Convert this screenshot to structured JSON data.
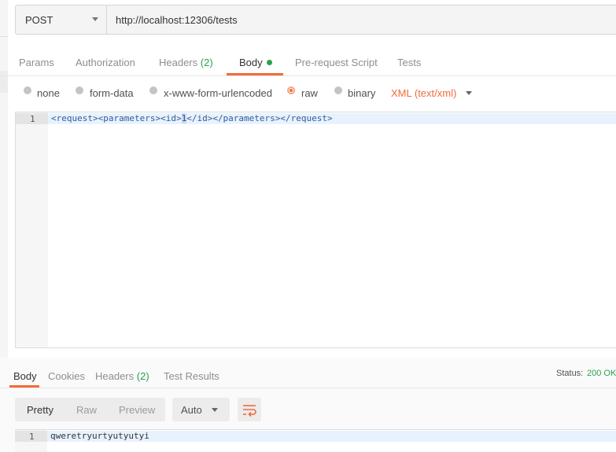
{
  "request": {
    "method": "POST",
    "url": "http://localhost:12306/tests"
  },
  "request_tabs": [
    {
      "label": "Params"
    },
    {
      "label": "Authorization"
    },
    {
      "label": "Headers",
      "count": "(2)"
    },
    {
      "label": "Body"
    },
    {
      "label": "Pre-request Script"
    },
    {
      "label": "Tests"
    }
  ],
  "body_types": [
    {
      "label": "none"
    },
    {
      "label": "form-data"
    },
    {
      "label": "x-www-form-urlencoded"
    },
    {
      "label": "raw",
      "selected": true
    },
    {
      "label": "binary"
    }
  ],
  "content_type": "XML (text/xml)",
  "editor": {
    "line_number": "1",
    "code_before": "<request><parameters><id>",
    "code_selected": "1",
    "code_after": "</id></parameters></request>"
  },
  "response_tabs": [
    {
      "label": "Body"
    },
    {
      "label": "Cookies"
    },
    {
      "label": "Headers",
      "count": "(2)"
    },
    {
      "label": "Test Results"
    }
  ],
  "status": {
    "label": "Status:",
    "value": "200 OK"
  },
  "view_modes": [
    "Pretty",
    "Raw",
    "Preview"
  ],
  "format": "Auto",
  "response_editor": {
    "line_number": "1",
    "code": "qweretryurtyutyutyi"
  },
  "colors": {
    "accent": "#f26b3a",
    "success": "#2aa050"
  }
}
